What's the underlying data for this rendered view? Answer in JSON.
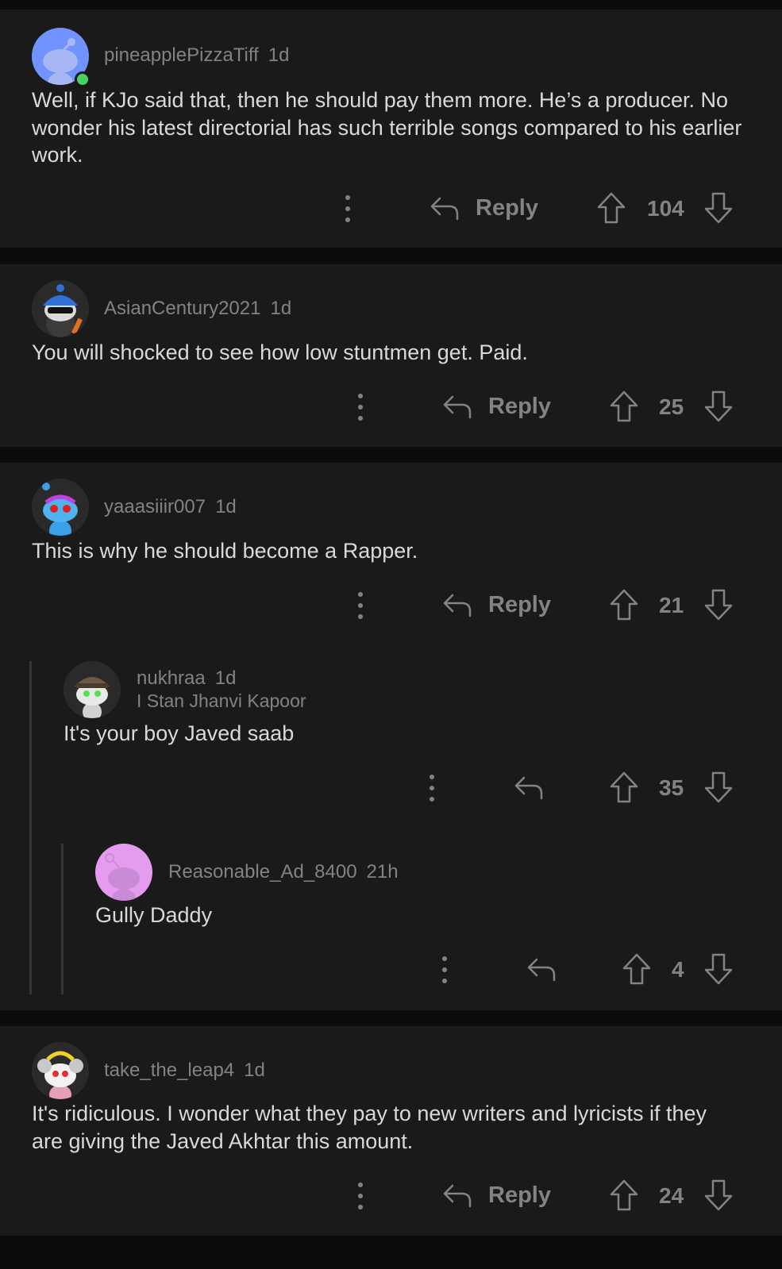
{
  "comments": [
    {
      "user": "pineapplePizzaTiff",
      "time": "1d",
      "online": true,
      "text": "Well, if KJo said that, then he should pay them more. He’s a producer. No wonder his latest directorial has such terrible songs compared to his earlier work.",
      "reply_label": "Reply",
      "votes": "104",
      "avatar": "snoo-avatar-blue"
    },
    {
      "user": "AsianCentury2021",
      "time": "1d",
      "text": "You will shocked to see how low stuntmen get. Paid.",
      "reply_label": "Reply",
      "votes": "25",
      "avatar": "snoo-avatar-sunglasses"
    },
    {
      "user": "yaaasiiir007",
      "time": "1d",
      "text": "This is why he should become a Rapper.",
      "reply_label": "Reply",
      "votes": "21",
      "avatar": "snoo-avatar-blue-face"
    },
    {
      "user": "nukhraa",
      "time": "1d",
      "flair": "I Stan Jhanvi Kapoor",
      "text": "It's your boy Javed saab",
      "votes": "35",
      "avatar": "snoo-avatar-hat"
    },
    {
      "user": "Reasonable_Ad_8400",
      "time": "21h",
      "text": "Gully Daddy",
      "votes": "4",
      "avatar": "snoo-avatar-purple"
    },
    {
      "user": "take_the_leap4",
      "time": "1d",
      "text": "It's ridiculous. I wonder what they pay to new writers and lyricists if they are giving the Javed Akhtar this amount.",
      "reply_label": "Reply",
      "votes": "24",
      "avatar": "snoo-avatar-koala"
    }
  ],
  "icons": {
    "more": "more-vertical-icon",
    "reply": "reply-arrow-icon",
    "up": "upvote-icon",
    "down": "downvote-icon"
  },
  "colors": {
    "background": "#0b0b0c",
    "card": "#1a1a1b",
    "text": "#d7dadc",
    "meta": "#818384",
    "online": "#46d160"
  }
}
